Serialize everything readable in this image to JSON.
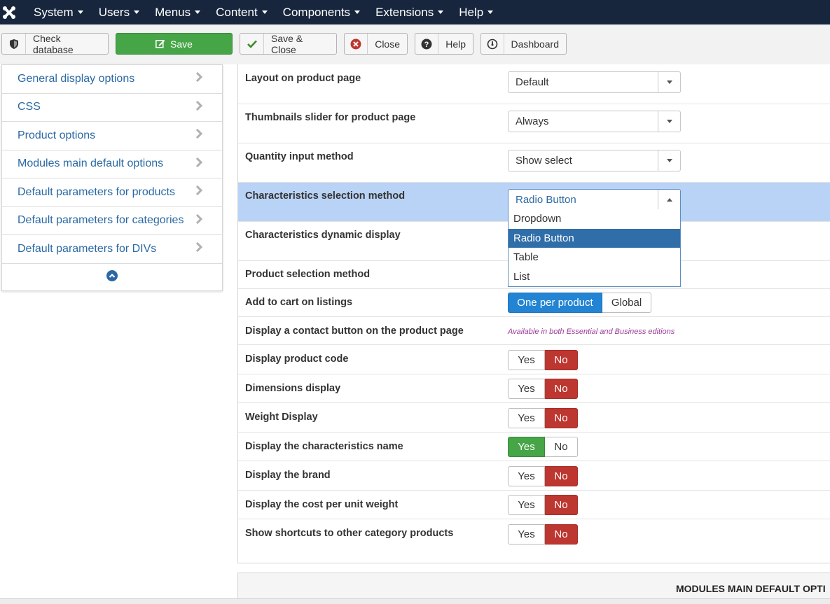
{
  "nav": {
    "items": [
      "System",
      "Users",
      "Menus",
      "Content",
      "Components",
      "Extensions",
      "Help"
    ]
  },
  "toolbar": {
    "check_db": "Check database",
    "save": "Save",
    "save_close": "Save & Close",
    "close": "Close",
    "help": "Help",
    "dashboard": "Dashboard"
  },
  "sidebar": {
    "items": [
      "General display options",
      "CSS",
      "Product options",
      "Modules main default options",
      "Default parameters for products",
      "Default parameters for categories",
      "Default parameters for DIVs"
    ]
  },
  "form": {
    "layout": {
      "label": "Layout on product page",
      "value": "Default"
    },
    "thumbs": {
      "label": "Thumbnails slider for product page",
      "value": "Always"
    },
    "qty": {
      "label": "Quantity input method",
      "value": "Show select"
    },
    "char_method": {
      "label": "Characteristics selection method",
      "value": "Radio Button",
      "options": [
        "Dropdown",
        "Radio Button",
        "Table",
        "List"
      ]
    },
    "char_dynamic": {
      "label": "Characteristics dynamic display"
    },
    "prod_sel": {
      "label": "Product selection method"
    },
    "add_cart": {
      "label": "Add to cart on listings",
      "opt1": "One per product",
      "opt2": "Global"
    },
    "contact": {
      "label": "Display a contact button on the product page",
      "note": "Available in both Essential and Business editions"
    },
    "yesno": {
      "yes": "Yes",
      "no": "No"
    },
    "prod_code": {
      "label": "Display product code",
      "selected": "No"
    },
    "dimensions": {
      "label": "Dimensions display",
      "selected": "No"
    },
    "weight": {
      "label": "Weight Display",
      "selected": "No"
    },
    "char_name": {
      "label": "Display the characteristics name",
      "selected": "Yes"
    },
    "brand": {
      "label": "Display the brand",
      "selected": "No"
    },
    "cost_unit": {
      "label": "Display the cost per unit weight",
      "selected": "No"
    },
    "shortcuts": {
      "label": "Show shortcuts to other category products",
      "selected": "No"
    }
  },
  "section2": {
    "title": "MODULES MAIN DEFAULT OPTI"
  },
  "colors": {
    "nav_bg": "#17263d",
    "save_green": "#46a546",
    "no_red": "#bd362f",
    "highlight": "#b9d3f6",
    "link_blue": "#2a69a3"
  }
}
